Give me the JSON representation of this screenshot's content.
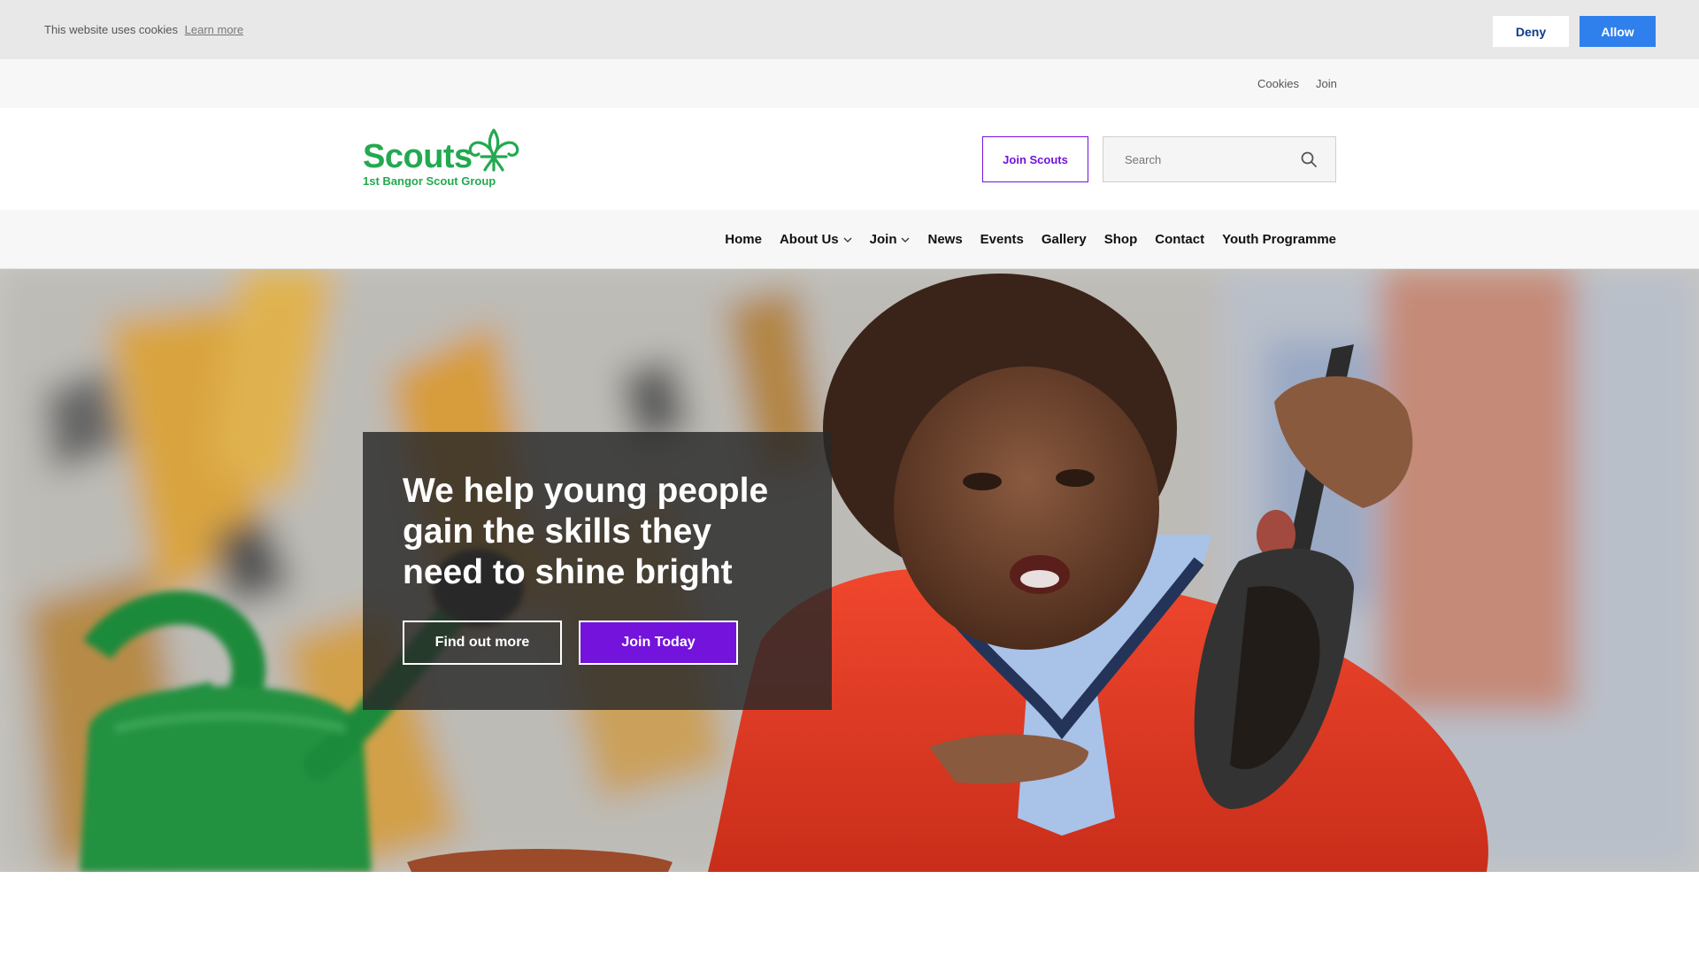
{
  "cookie_bar": {
    "message": "This website uses cookies",
    "learn_more": "Learn more",
    "deny_label": "Deny",
    "allow_label": "Allow"
  },
  "utility_nav": {
    "items": [
      {
        "label": "Cookies"
      },
      {
        "label": "Join"
      }
    ]
  },
  "header": {
    "logo_word": "Scouts",
    "logo_subtitle": "1st Bangor Scout Group",
    "join_button": "Join Scouts",
    "search_placeholder": "Search"
  },
  "main_nav": {
    "items": [
      {
        "label": "Home",
        "has_dropdown": false
      },
      {
        "label": "About Us",
        "has_dropdown": true
      },
      {
        "label": "Join",
        "has_dropdown": true
      },
      {
        "label": "News",
        "has_dropdown": false
      },
      {
        "label": "Events",
        "has_dropdown": false
      },
      {
        "label": "Gallery",
        "has_dropdown": false
      },
      {
        "label": "Shop",
        "has_dropdown": false
      },
      {
        "label": "Contact",
        "has_dropdown": false
      },
      {
        "label": "Youth Programme",
        "has_dropdown": false
      }
    ]
  },
  "hero": {
    "headline": "We help young people gain the skills they need to shine bright",
    "primary_cta": "Find out more",
    "secondary_cta": "Join Today"
  },
  "colors": {
    "brand_green": "#23a950",
    "brand_purple": "#7413dc",
    "allow_blue": "#2f80ed"
  },
  "icons": [
    "fleur-de-lis-icon",
    "search-icon",
    "chevron-down-icon"
  ]
}
